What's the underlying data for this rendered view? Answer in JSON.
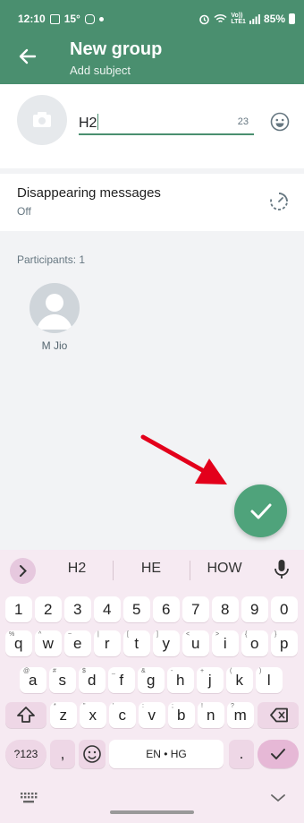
{
  "status_bar": {
    "time": "12:10",
    "temperature": "15°",
    "network_top": "Vo))",
    "network_bottom": "LTE1",
    "battery": "85%"
  },
  "header": {
    "title": "New group",
    "subtitle": "Add subject"
  },
  "subject": {
    "value": "H2",
    "remaining_count": "23"
  },
  "disappearing": {
    "title": "Disappearing messages",
    "status": "Off"
  },
  "participants": {
    "label": "Participants: 1",
    "members": [
      {
        "name": "M Jio"
      }
    ]
  },
  "keyboard": {
    "suggestions": [
      "H2",
      "HE",
      "HOW"
    ],
    "row_numbers": [
      "1",
      "2",
      "3",
      "4",
      "5",
      "6",
      "7",
      "8",
      "9",
      "0"
    ],
    "row1": [
      {
        "k": "q",
        "h": "%"
      },
      {
        "k": "w",
        "h": "^"
      },
      {
        "k": "e",
        "h": "~"
      },
      {
        "k": "r",
        "h": "|"
      },
      {
        "k": "t",
        "h": "["
      },
      {
        "k": "y",
        "h": "]"
      },
      {
        "k": "u",
        "h": "<"
      },
      {
        "k": "i",
        "h": ">"
      },
      {
        "k": "o",
        "h": "{"
      },
      {
        "k": "p",
        "h": "}"
      }
    ],
    "row2": [
      {
        "k": "a",
        "h": "@"
      },
      {
        "k": "s",
        "h": "#"
      },
      {
        "k": "d",
        "h": "$"
      },
      {
        "k": "f",
        "h": "_"
      },
      {
        "k": "g",
        "h": "&"
      },
      {
        "k": "h",
        "h": "-"
      },
      {
        "k": "j",
        "h": "+"
      },
      {
        "k": "k",
        "h": "("
      },
      {
        "k": "l",
        "h": ")"
      }
    ],
    "row3": [
      {
        "k": "z",
        "h": "*"
      },
      {
        "k": "x",
        "h": "\""
      },
      {
        "k": "c",
        "h": "'"
      },
      {
        "k": "v",
        "h": ":"
      },
      {
        "k": "b",
        "h": ";"
      },
      {
        "k": "n",
        "h": "!"
      },
      {
        "k": "m",
        "h": "?"
      }
    ],
    "symbols_key": "?123",
    "comma_key": ",",
    "space_key": "EN • HG",
    "period_key": "."
  },
  "colors": {
    "accent": "#4a8f6f",
    "fab": "#4fa37b",
    "keyboard_bg": "#f6eaf2",
    "arrow": "#e3001b"
  },
  "icons": {
    "back": "arrow-left-icon",
    "camera": "camera-icon",
    "emoji": "smiley-icon",
    "timer": "timer-icon",
    "fab": "checkmark-icon",
    "mic": "microphone-icon"
  }
}
